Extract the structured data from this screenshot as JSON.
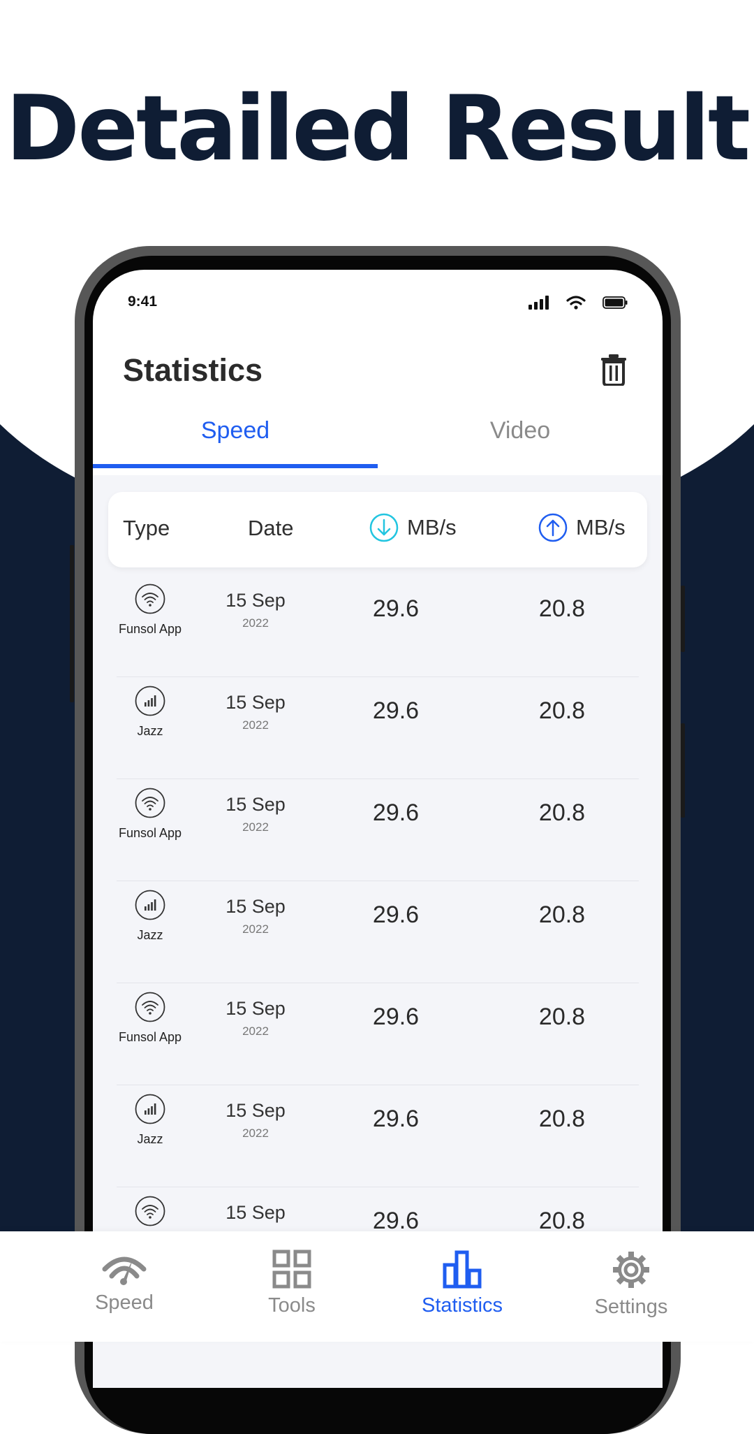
{
  "headline": "Detailed Result",
  "colors": {
    "navy": "#0f1d34",
    "accent": "#1f5df0",
    "cyan": "#22c5e0"
  },
  "status_bar": {
    "time": "9:41"
  },
  "app": {
    "title": "Statistics"
  },
  "tabs": [
    {
      "label": "Speed",
      "active": true
    },
    {
      "label": "Video",
      "active": false
    }
  ],
  "table_header": {
    "type": "Type",
    "date": "Date",
    "download_unit": "MB/s",
    "upload_unit": "MB/s"
  },
  "rows": [
    {
      "icon": "wifi-icon",
      "type": "Funsol App",
      "date": "15 Sep",
      "year": "2022",
      "download": "29.6",
      "upload": "20.8"
    },
    {
      "icon": "cellular-signal-icon",
      "type": "Jazz",
      "date": "15 Sep",
      "year": "2022",
      "download": "29.6",
      "upload": "20.8"
    },
    {
      "icon": "wifi-icon",
      "type": "Funsol App",
      "date": "15 Sep",
      "year": "2022",
      "download": "29.6",
      "upload": "20.8"
    },
    {
      "icon": "cellular-signal-icon",
      "type": "Jazz",
      "date": "15 Sep",
      "year": "2022",
      "download": "29.6",
      "upload": "20.8"
    },
    {
      "icon": "wifi-icon",
      "type": "Funsol App",
      "date": "15 Sep",
      "year": "2022",
      "download": "29.6",
      "upload": "20.8"
    },
    {
      "icon": "cellular-signal-icon",
      "type": "Jazz",
      "date": "15 Sep",
      "year": "2022",
      "download": "29.6",
      "upload": "20.8"
    },
    {
      "icon": "wifi-icon",
      "type": "",
      "date": "15 Sep",
      "year": "",
      "download": "29.6",
      "upload": "20.8"
    }
  ],
  "bottom_nav": [
    {
      "label": "Speed",
      "icon": "speedometer-icon",
      "active": false
    },
    {
      "label": "Tools",
      "icon": "grid-icon",
      "active": false
    },
    {
      "label": "Statistics",
      "icon": "bar-chart-icon",
      "active": true
    },
    {
      "label": "Settings",
      "icon": "gear-icon",
      "active": false
    }
  ]
}
